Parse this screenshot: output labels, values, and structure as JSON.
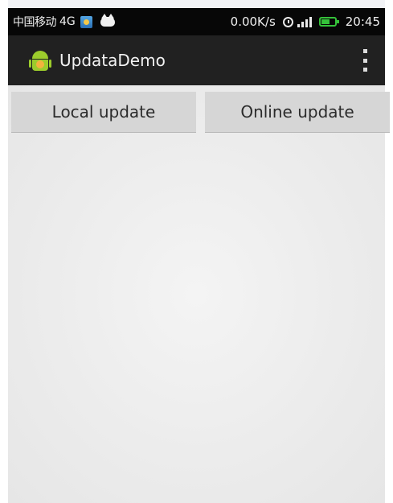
{
  "status_bar": {
    "carrier": "中国移动",
    "network": "4G",
    "net_speed": "0.00K/s",
    "time": "20:45",
    "icons": [
      "notification-icon",
      "cat-icon",
      "alarm-icon",
      "signal-icon",
      "battery-icon"
    ]
  },
  "action_bar": {
    "app_icon": "android-app-icon",
    "title": "UpdataDemo",
    "overflow_icon": "overflow-menu-icon"
  },
  "buttons": {
    "local_update": "Local update",
    "online_update": "Online update"
  },
  "colors": {
    "status_bar_bg": "#070707",
    "action_bar_bg": "#212121",
    "button_bg": "#d6d6d6",
    "battery": "#35c23a",
    "android_green": "#9ccc2c"
  }
}
